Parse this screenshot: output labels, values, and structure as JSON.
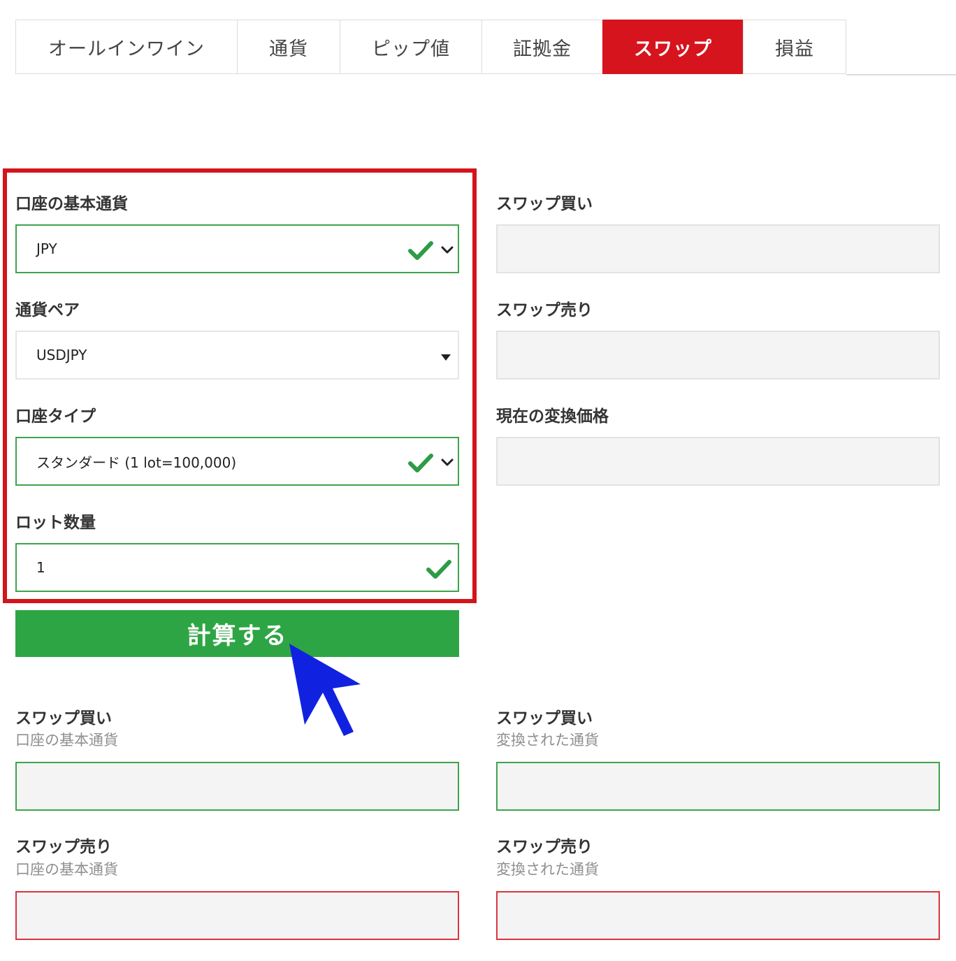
{
  "tabs": [
    {
      "label": "オールインワイン",
      "active": false
    },
    {
      "label": "通貨",
      "active": false
    },
    {
      "label": "ピップ値",
      "active": false
    },
    {
      "label": "証拠金",
      "active": false
    },
    {
      "label": "スワップ",
      "active": true
    },
    {
      "label": "損益",
      "active": false
    }
  ],
  "form": {
    "base_currency": {
      "label": "口座の基本通貨",
      "value": "JPY"
    },
    "currency_pair": {
      "label": "通貨ペア",
      "value": "USDJPY"
    },
    "account_type": {
      "label": "口座タイプ",
      "value": "スタンダード (1 lot=100,000)"
    },
    "lot_quantity": {
      "label": "ロット数量",
      "value": "1"
    }
  },
  "calculate_button": "計算する",
  "results_top": {
    "swap_buy": {
      "label": "スワップ買い",
      "value": ""
    },
    "swap_sell": {
      "label": "スワップ売り",
      "value": ""
    },
    "conversion_price": {
      "label": "現在の変換価格",
      "value": ""
    }
  },
  "results_bottom": {
    "swap_buy_base": {
      "label": "スワップ買い",
      "sublabel": "口座の基本通貨",
      "value": ""
    },
    "swap_buy_converted": {
      "label": "スワップ買い",
      "sublabel": "変換された通貨",
      "value": ""
    },
    "swap_sell_base": {
      "label": "スワップ売り",
      "sublabel": "口座の基本通貨",
      "value": ""
    },
    "swap_sell_converted": {
      "label": "スワップ売り",
      "sublabel": "変換された通貨",
      "value": ""
    }
  },
  "colors": {
    "active_tab": "#d6141e",
    "highlight_frame": "#d4141b",
    "button": "#2ea544",
    "valid_border": "#3fa34d",
    "check": "#2e9c46",
    "cursor": "#1022e0"
  },
  "icons": {
    "check": "check-icon",
    "dropdown": "chevron-down-icon",
    "caret": "caret-down-icon",
    "pointer": "mouse-cursor-icon"
  }
}
